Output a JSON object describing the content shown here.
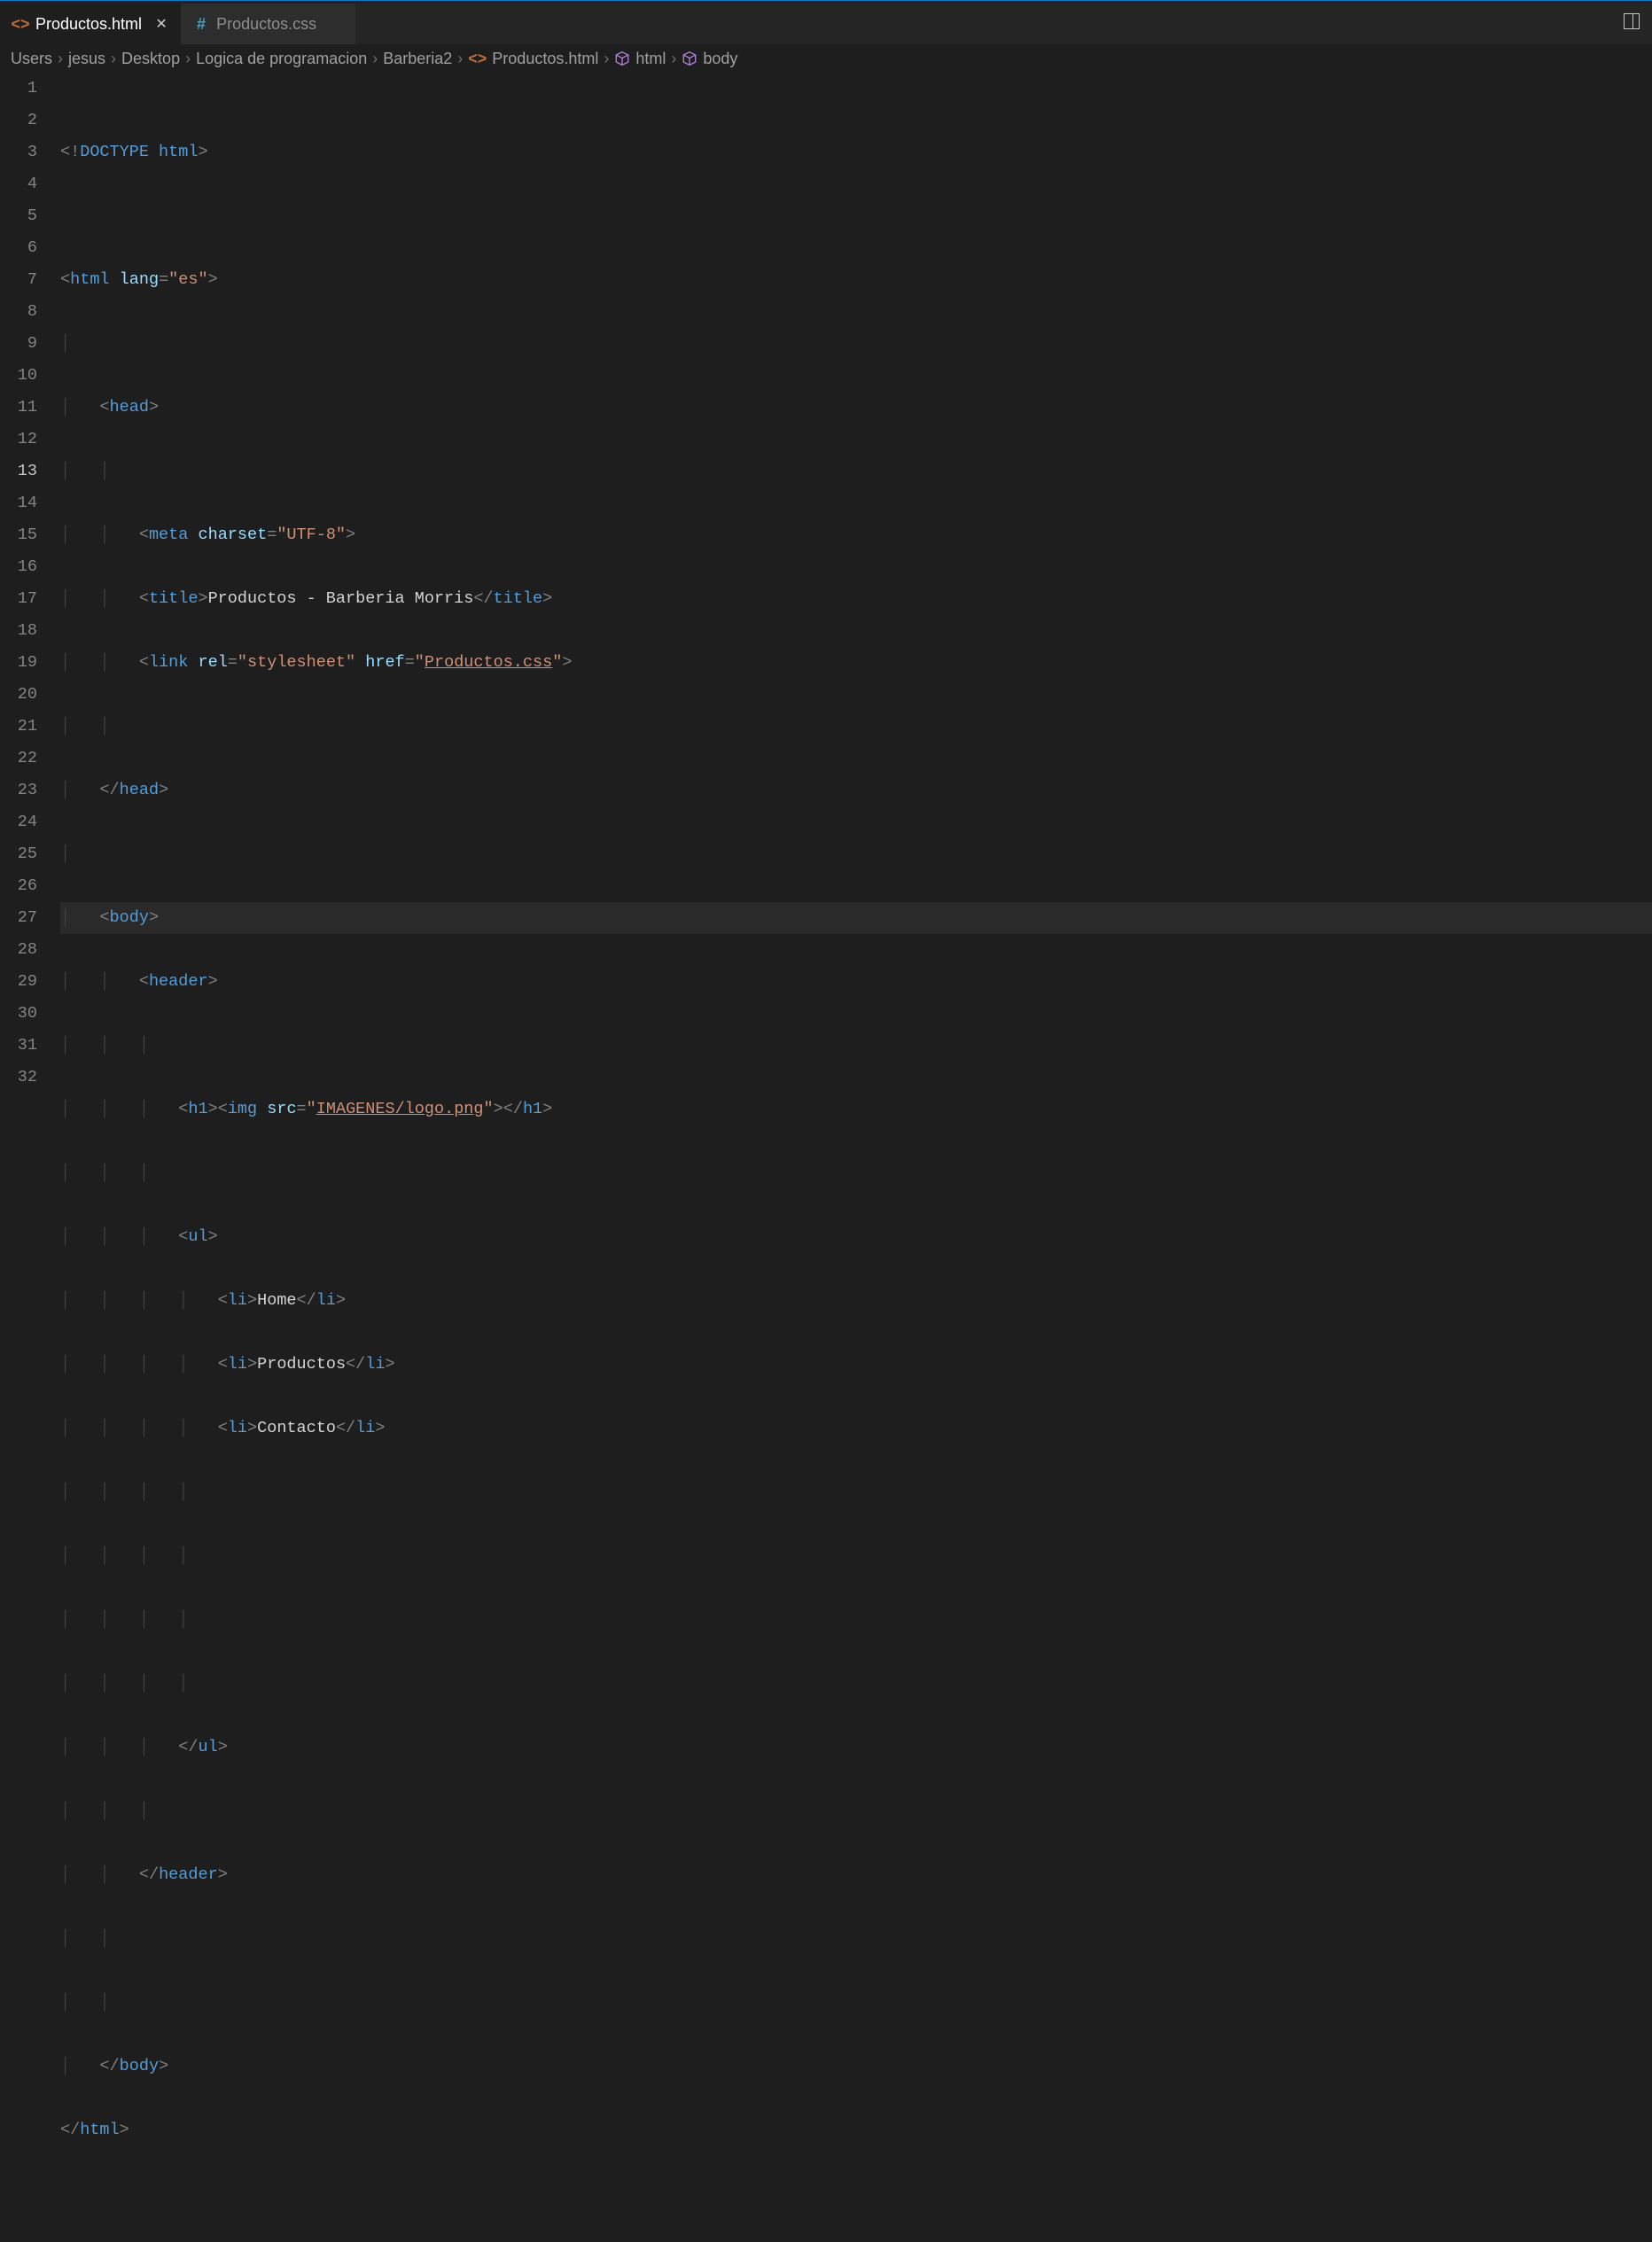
{
  "tabs": [
    {
      "label": "Productos.html",
      "icon": "html-file-icon",
      "active": true
    },
    {
      "label": "Productos.css",
      "icon": "css-file-icon",
      "active": false
    }
  ],
  "editor_action": "split-editor",
  "breadcrumb": {
    "items": [
      {
        "label": "Users"
      },
      {
        "label": "jesus"
      },
      {
        "label": "Desktop"
      },
      {
        "label": "Logica de programacion"
      },
      {
        "label": "Barberia2"
      },
      {
        "label": "Productos.html",
        "icon": "html-file-icon"
      },
      {
        "label": "html",
        "icon": "symbol-cube-icon"
      },
      {
        "label": "body",
        "icon": "symbol-cube-icon"
      }
    ],
    "separator": "›"
  },
  "gutter": {
    "lines": 32,
    "active_line": 13
  },
  "code": {
    "line1": {
      "doctype_open": "<!",
      "doctype": "DOCTYPE",
      "space": " ",
      "doctype_arg": "html",
      "close": ">"
    },
    "line3": {
      "open": "<",
      "tag": "html",
      "attr": "lang",
      "eq": "=",
      "val": "\"es\"",
      "close": ">"
    },
    "line5": {
      "open": "<",
      "tag": "head",
      "close": ">"
    },
    "line7": {
      "open": "<",
      "tag": "meta",
      "attr": "charset",
      "eq": "=",
      "val": "\"UTF-8\"",
      "close": ">"
    },
    "line8": {
      "open": "<",
      "tag": "title",
      "close": ">",
      "text": "Productos - Barberia Morris",
      "open2": "</",
      "tag2": "title",
      "close2": ">"
    },
    "line9": {
      "open": "<",
      "tag": "link",
      "attr1": "rel",
      "eq": "=",
      "val1": "\"stylesheet\"",
      "attr2": "href",
      "val2a": "\"",
      "val2b": "Productos.css",
      "val2c": "\"",
      "close": ">"
    },
    "line11": {
      "open": "</",
      "tag": "head",
      "close": ">"
    },
    "line13": {
      "open": "<",
      "tag": "body",
      "close": ">"
    },
    "line14": {
      "open": "<",
      "tag": "header",
      "close": ">"
    },
    "line16": {
      "open1": "<",
      "tag1": "h1",
      "close1": ">",
      "open2": "<",
      "tag2": "img",
      "attr": "src",
      "eq": "=",
      "valA": "\"",
      "valB": "IMAGENES/logo.png",
      "valC": "\"",
      "close2": ">",
      "open3": "</",
      "tag3": "h1",
      "close3": ">"
    },
    "line18": {
      "open": "<",
      "tag": "ul",
      "close": ">"
    },
    "line19": {
      "open": "<",
      "tag": "li",
      "close": ">",
      "text": "Home",
      "open2": "</",
      "tag2": "li",
      "close2": ">"
    },
    "line20": {
      "open": "<",
      "tag": "li",
      "close": ">",
      "text": "Productos",
      "open2": "</",
      "tag2": "li",
      "close2": ">"
    },
    "line21": {
      "open": "<",
      "tag": "li",
      "close": ">",
      "text": "Contacto",
      "open2": "</",
      "tag2": "li",
      "close2": ">"
    },
    "line26": {
      "open": "</",
      "tag": "ul",
      "close": ">"
    },
    "line28": {
      "open": "</",
      "tag": "header",
      "close": ">"
    },
    "line31": {
      "open": "</",
      "tag": "body",
      "close": ">"
    },
    "line32": {
      "open": "</",
      "tag": "html",
      "close": ">"
    }
  }
}
